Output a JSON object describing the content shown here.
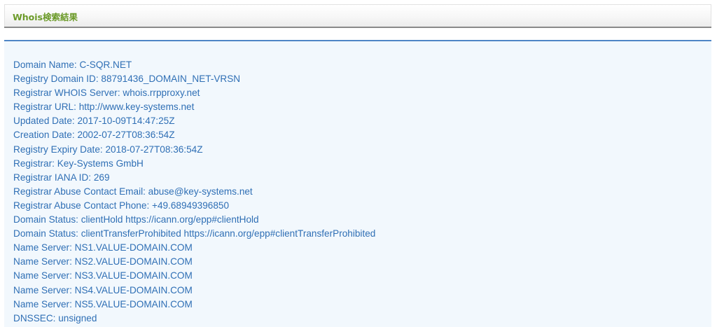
{
  "header": {
    "title": "Whois検索結果"
  },
  "whois": {
    "lines": [
      {
        "key": "Domain Name",
        "value": "C-SQR.NET"
      },
      {
        "key": "Registry Domain ID",
        "value": "88791436_DOMAIN_NET-VRSN"
      },
      {
        "key": "Registrar WHOIS Server",
        "value": "whois.rrpproxy.net"
      },
      {
        "key": "Registrar URL",
        "value": "http://www.key-systems.net"
      },
      {
        "key": "Updated Date",
        "value": "2017-10-09T14:47:25Z"
      },
      {
        "key": "Creation Date",
        "value": "2002-07-27T08:36:54Z"
      },
      {
        "key": "Registry Expiry Date",
        "value": "2018-07-27T08:36:54Z"
      },
      {
        "key": "Registrar",
        "value": "Key-Systems GmbH"
      },
      {
        "key": "Registrar IANA ID",
        "value": "269"
      },
      {
        "key": "Registrar Abuse Contact Email",
        "value": "abuse@key-systems.net"
      },
      {
        "key": "Registrar Abuse Contact Phone",
        "value": "+49.68949396850"
      },
      {
        "key": "Domain Status",
        "value": "clientHold https://icann.org/epp#clientHold"
      },
      {
        "key": "Domain Status",
        "value": "clientTransferProhibited https://icann.org/epp#clientTransferProhibited"
      },
      {
        "key": "Name Server",
        "value": "NS1.VALUE-DOMAIN.COM"
      },
      {
        "key": "Name Server",
        "value": "NS2.VALUE-DOMAIN.COM"
      },
      {
        "key": "Name Server",
        "value": "NS3.VALUE-DOMAIN.COM"
      },
      {
        "key": "Name Server",
        "value": "NS4.VALUE-DOMAIN.COM"
      },
      {
        "key": "Name Server",
        "value": "NS5.VALUE-DOMAIN.COM"
      },
      {
        "key": "DNSSEC",
        "value": "unsigned"
      }
    ]
  },
  "colors": {
    "title": "#6b9a28",
    "text": "#2f6fb5",
    "panel_border": "#4f86c6",
    "panel_background": "#f2f8fd"
  }
}
